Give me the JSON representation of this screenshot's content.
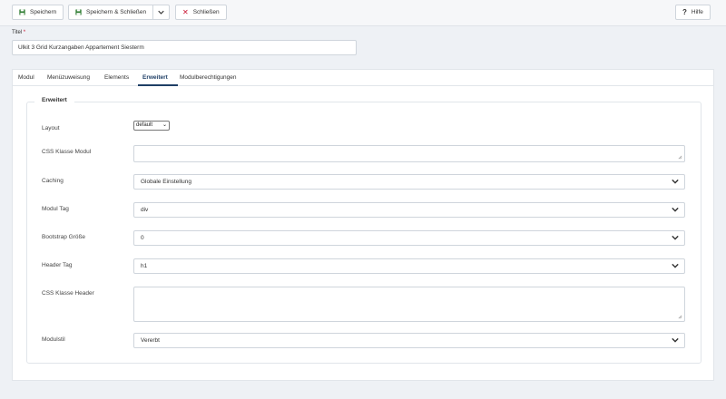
{
  "toolbar": {
    "save_label": "Speichern",
    "save_close_label": "Speichern & Schließen",
    "close_label": "Schließen",
    "help_label": "Hilfe"
  },
  "title_field": {
    "label": "Titel",
    "required_mark": "*",
    "value": "Ulkit 3 Grid Kurzangaben Appartement Siesterm"
  },
  "tabs": [
    {
      "label": "Modul"
    },
    {
      "label": "Menüzuweisung"
    },
    {
      "label": "Elements"
    },
    {
      "label": "Erweitert",
      "active": true
    },
    {
      "label": "Modulberechtigungen"
    }
  ],
  "advanced": {
    "legend": "Erweitert",
    "layout": {
      "label": "Layout",
      "value": "default"
    },
    "css_module": {
      "label": "CSS Klasse Modul",
      "value": ""
    },
    "caching": {
      "label": "Caching",
      "value": "Globale Einstellung"
    },
    "module_tag": {
      "label": "Modul Tag",
      "value": "div"
    },
    "bootstrap_size": {
      "label": "Bootstrap Größe",
      "value": "0"
    },
    "header_tag": {
      "label": "Header Tag",
      "value": "h1"
    },
    "css_header": {
      "label": "CSS Klasse Header",
      "value": ""
    },
    "module_style": {
      "label": "Modulstil",
      "value": "Vererbt"
    }
  },
  "colors": {
    "accent": "#1f3f66",
    "save_icon": "#2f7d32",
    "close_icon": "#c8102e"
  }
}
